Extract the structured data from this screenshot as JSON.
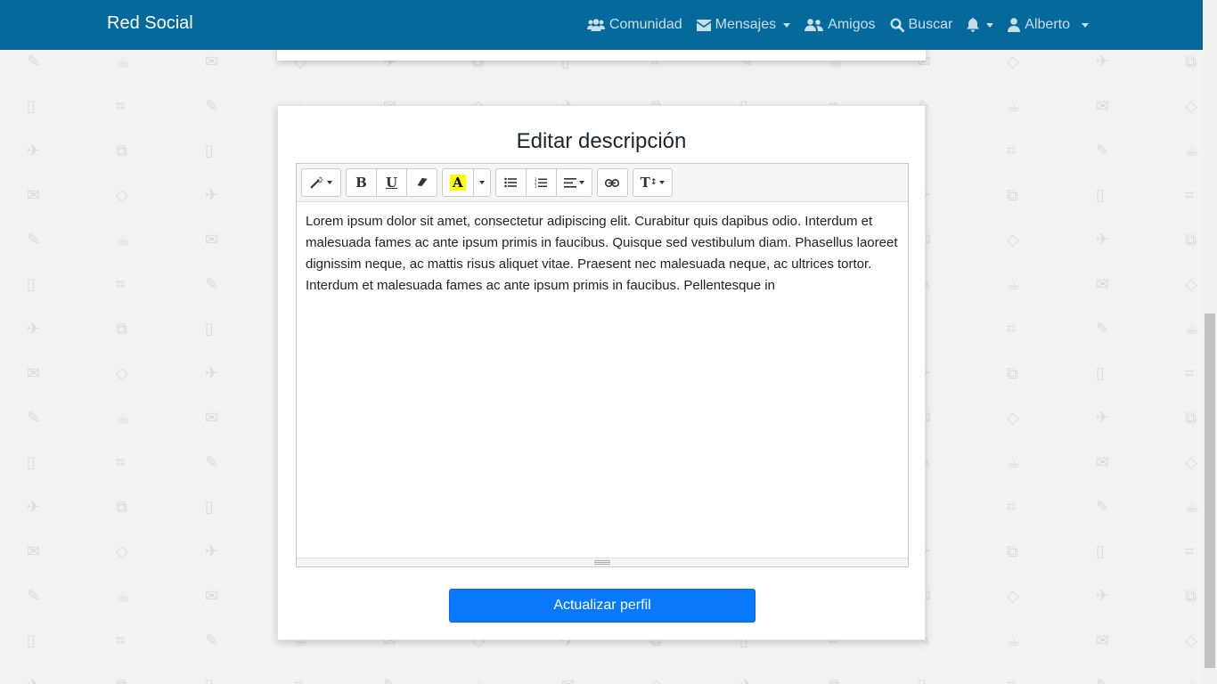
{
  "navbar": {
    "brand": "Red Social",
    "items": [
      {
        "label": "Comunidad",
        "icon": "users-icon",
        "dropdown": false
      },
      {
        "label": "Mensajes",
        "icon": "envelope-icon",
        "dropdown": true
      },
      {
        "label": "Amigos",
        "icon": "user-friends-icon",
        "dropdown": false
      },
      {
        "label": "Buscar",
        "icon": "search-icon",
        "dropdown": false
      },
      {
        "label": "",
        "icon": "bell-icon",
        "dropdown": true
      },
      {
        "label": "Alberto",
        "icon": "user-icon",
        "dropdown": true
      }
    ],
    "color": "#06699b"
  },
  "card": {
    "title": "Editar descripción"
  },
  "editor": {
    "toolbar": {
      "style": "magic-wand-icon",
      "bold": "B",
      "underline": "U",
      "clear": "eraser-icon",
      "color": "A",
      "ul": "unordered-list-icon",
      "ol": "ordered-list-icon",
      "align": "align-icon",
      "link": "link-icon",
      "height": "T"
    },
    "content": "Lorem ipsum dolor sit amet, consectetur adipiscing elit. Curabitur quis dapibus odio. Interdum et malesuada fames ac ante ipsum primis in faucibus. Quisque sed vestibulum diam. Phasellus laoreet dignissim neque, ac mattis risus aliquet vitae. Praesent nec malesuada neque, ac ultrices tortor. Interdum et malesuada fames ac ante ipsum primis in faucibus. Pellentesque in"
  },
  "submit": {
    "label": "Actualizar perfil",
    "color": "#0779fa"
  }
}
